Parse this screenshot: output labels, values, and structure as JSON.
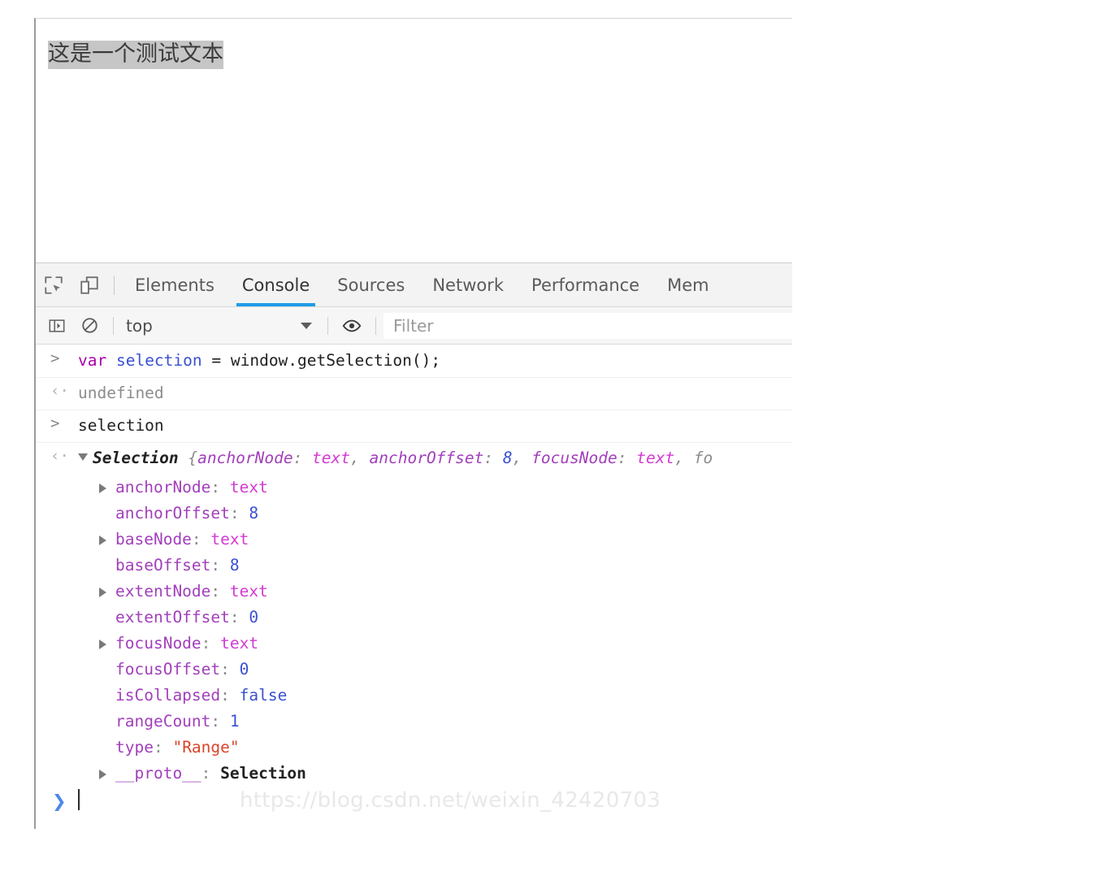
{
  "page": {
    "selected_text": "这是一个测试文本",
    "selection_highlight_color": "#c6c6c6"
  },
  "devtools": {
    "toolbar_icons": [
      {
        "name": "inspect-element-icon",
        "label": "Inspect element"
      },
      {
        "name": "toggle-device-toolbar-icon",
        "label": "Toggle device toolbar"
      }
    ],
    "tabs": [
      {
        "label": "Elements",
        "active": false
      },
      {
        "label": "Console",
        "active": true
      },
      {
        "label": "Sources",
        "active": false
      },
      {
        "label": "Network",
        "active": false
      },
      {
        "label": "Performance",
        "active": false
      },
      {
        "label": "Mem",
        "active": false
      }
    ],
    "active_tab_underline_color": "#1e9ce8"
  },
  "console_toolbar": {
    "sidebar_toggle_icon": "console-sidebar-icon",
    "clear_console_icon": "clear-console-icon",
    "context_selector": {
      "value": "top",
      "caret_icon": "chevron-down-icon"
    },
    "live_expression_icon": "eye-icon",
    "filter": {
      "value": "",
      "placeholder": "Filter"
    }
  },
  "console": {
    "entries": [
      {
        "kind": "input",
        "gutter": ">",
        "tokens": [
          {
            "text": "var ",
            "cls": "t-keyword"
          },
          {
            "text": "selection ",
            "cls": "t-ident"
          },
          {
            "text": "= window.getSelection();",
            "cls": "t-plain"
          }
        ]
      },
      {
        "kind": "output",
        "gutter": "‹·",
        "tokens": [
          {
            "text": "undefined",
            "cls": "t-dim"
          }
        ]
      },
      {
        "kind": "input",
        "gutter": ">",
        "tokens": [
          {
            "text": "selection",
            "cls": "t-plain"
          }
        ]
      }
    ],
    "result_object": {
      "gutter": "‹·",
      "expanded": true,
      "summary": {
        "class_name": "Selection",
        "preview": " {anchorNode: text, anchorOffset: 8, focusNode: text, fo",
        "preview_parts": [
          {
            "text": " {",
            "cls": "t-dim"
          },
          {
            "text": "anchorNode",
            "cls": "t-prop"
          },
          {
            "text": ": ",
            "cls": "t-dim"
          },
          {
            "text": "text",
            "cls": "t-node"
          },
          {
            "text": ", ",
            "cls": "t-dim"
          },
          {
            "text": "anchorOffset",
            "cls": "t-prop"
          },
          {
            "text": ": ",
            "cls": "t-dim"
          },
          {
            "text": "8",
            "cls": "t-num"
          },
          {
            "text": ", ",
            "cls": "t-dim"
          },
          {
            "text": "focusNode",
            "cls": "t-prop"
          },
          {
            "text": ": ",
            "cls": "t-dim"
          },
          {
            "text": "text",
            "cls": "t-node"
          },
          {
            "text": ", ",
            "cls": "t-dim"
          },
          {
            "text": "fo",
            "cls": "t-dim"
          }
        ]
      },
      "properties": [
        {
          "name": "anchorNode",
          "value": "text",
          "value_cls": "t-node",
          "expandable": true
        },
        {
          "name": "anchorOffset",
          "value": "8",
          "value_cls": "t-num",
          "expandable": false
        },
        {
          "name": "baseNode",
          "value": "text",
          "value_cls": "t-node",
          "expandable": true
        },
        {
          "name": "baseOffset",
          "value": "8",
          "value_cls": "t-num",
          "expandable": false
        },
        {
          "name": "extentNode",
          "value": "text",
          "value_cls": "t-node",
          "expandable": true
        },
        {
          "name": "extentOffset",
          "value": "0",
          "value_cls": "t-num",
          "expandable": false
        },
        {
          "name": "focusNode",
          "value": "text",
          "value_cls": "t-node",
          "expandable": true
        },
        {
          "name": "focusOffset",
          "value": "0",
          "value_cls": "t-num",
          "expandable": false
        },
        {
          "name": "isCollapsed",
          "value": "false",
          "value_cls": "t-bool",
          "expandable": false
        },
        {
          "name": "rangeCount",
          "value": "1",
          "value_cls": "t-num",
          "expandable": false
        },
        {
          "name": "type",
          "value": "\"Range\"",
          "value_cls": "t-str",
          "expandable": false
        },
        {
          "name": "__proto__",
          "value": "Selection",
          "value_cls": "t-class",
          "expandable": true
        }
      ]
    },
    "prompt": {
      "arrow": "❯",
      "value": ""
    }
  },
  "watermark": {
    "text": "https://blog.csdn.net/weixin_42420703",
    "color": "#e8e8e8"
  }
}
